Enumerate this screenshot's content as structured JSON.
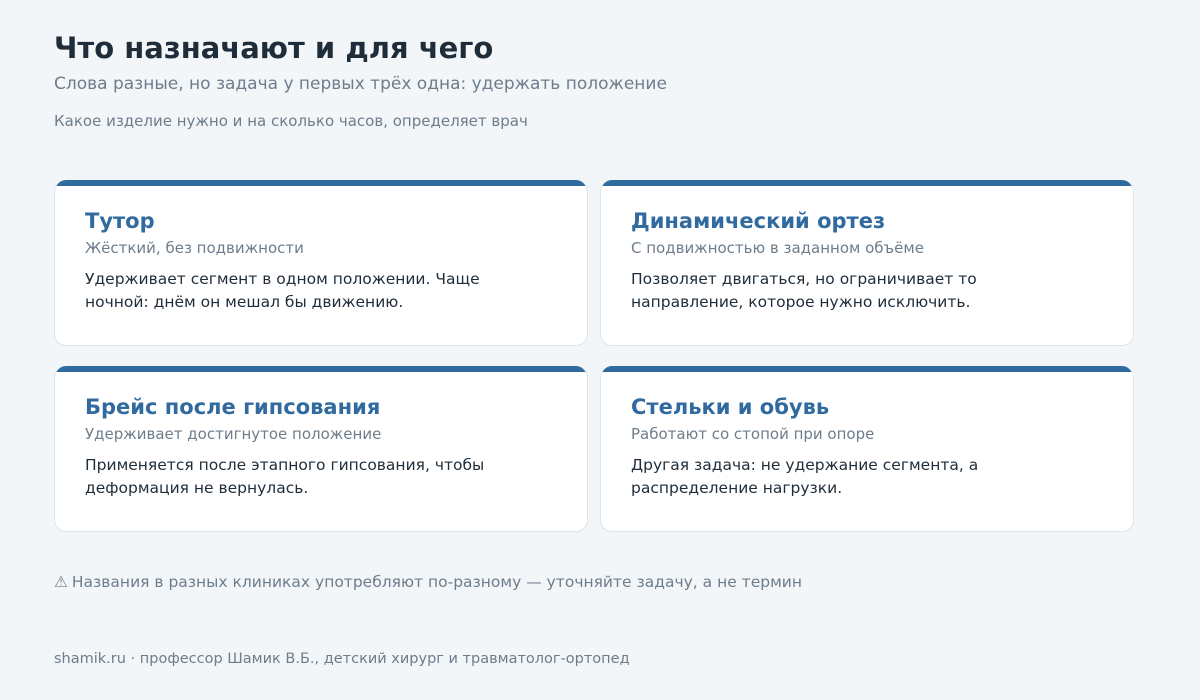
{
  "header": {
    "title": "Что назначают и для чего",
    "subtitle": "Слова разные, но задача у первых трёх одна: удержать положение",
    "note": "Какое изделие нужно и на сколько часов, определяет врач"
  },
  "accent_color": "#306a9f",
  "cards": [
    {
      "title": "Тутор",
      "subtitle": "Жёсткий, без подвижности",
      "text": "Удерживает сегмент в одном положении. Чаще ночной: днём он мешал бы движению."
    },
    {
      "title": "Динамический ортез",
      "subtitle": "С подвижностью в заданном объёме",
      "text": "Позволяет двигаться, но ограничивает то направление, которое нужно исключить."
    },
    {
      "title": "Брейс после гипсования",
      "subtitle": "Удерживает достигнутое положение",
      "text": "Применяется после этапного гипсования, чтобы деформация не вернулась."
    },
    {
      "title": "Стельки и обувь",
      "subtitle": "Работают со стопой при опоре",
      "text": "Другая задача: не удержание сегмента, а распределение нагрузки."
    }
  ],
  "warning": {
    "icon": "warning-icon",
    "icon_glyph": "⚠",
    "text": "Названия в разных клиниках употребляют по-разному — уточняйте задачу, а не термин"
  },
  "footer": {
    "text": "shamik.ru · профессор Шамик В.Б., детский хирург и травматолог-ортопед"
  }
}
